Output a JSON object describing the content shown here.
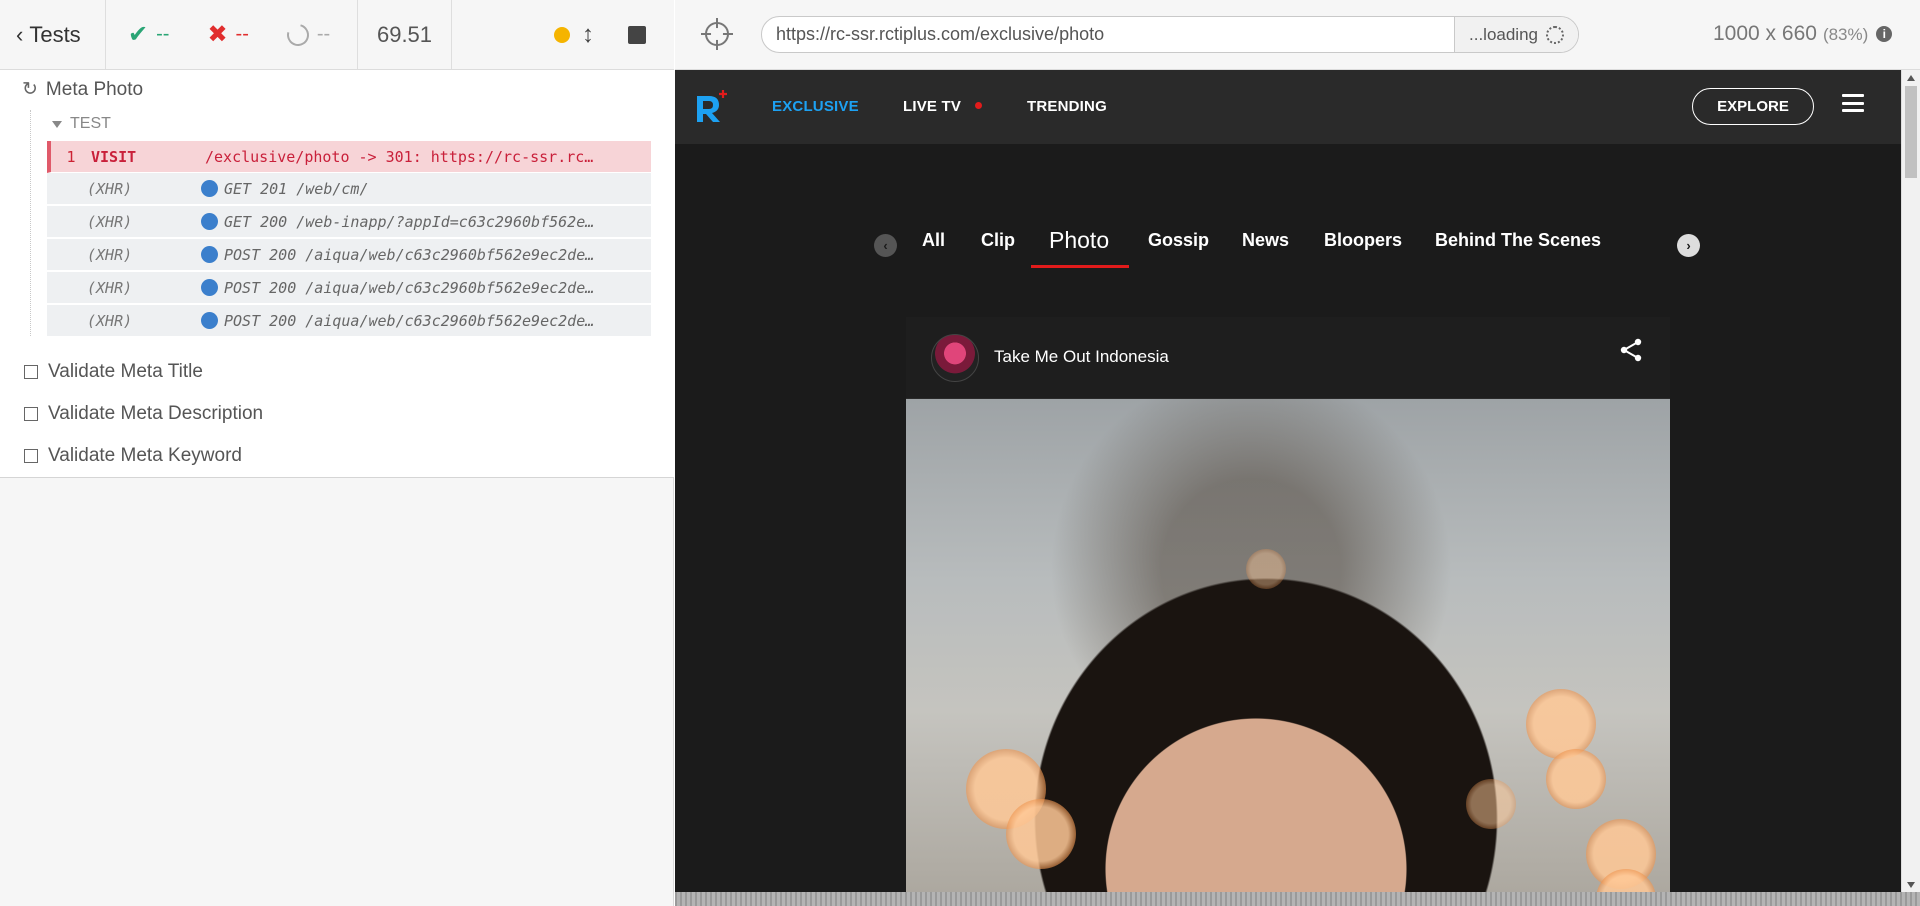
{
  "reporter": {
    "header": {
      "tests_label": "Tests",
      "passed": "--",
      "failed": "--",
      "pending": "--",
      "duration": "69.51"
    },
    "suite": {
      "title": "Meta Photo",
      "test_label": "TEST",
      "commands": [
        {
          "num": "1",
          "name": "VISIT",
          "message": "/exclusive/photo -> 301: https://rc-ssr.rc…",
          "type": "visit"
        },
        {
          "num": "",
          "name": "(XHR)",
          "message": "GET 201 /web/cm/",
          "type": "xhr"
        },
        {
          "num": "",
          "name": "(XHR)",
          "message": "GET 200 /web-inapp/?appId=c63c2960bf562e…",
          "type": "xhr"
        },
        {
          "num": "",
          "name": "(XHR)",
          "message": "POST 200 /aiqua/web/c63c2960bf562e9ec2de…",
          "type": "xhr"
        },
        {
          "num": "",
          "name": "(XHR)",
          "message": "POST 200 /aiqua/web/c63c2960bf562e9ec2de…",
          "type": "xhr"
        },
        {
          "num": "",
          "name": "(XHR)",
          "message": "POST 200 /aiqua/web/c63c2960bf562e9ec2de…",
          "type": "xhr"
        }
      ],
      "pending_tests": [
        "Validate Meta Title",
        "Validate Meta Description",
        "Validate Meta Keyword"
      ]
    }
  },
  "aut": {
    "url": "https://rc-ssr.rctiplus.com/exclusive/photo",
    "status": "...loading",
    "viewport": "1000 x 660",
    "scale": "(83%)",
    "site": {
      "nav": [
        "EXCLUSIVE",
        "LIVE TV",
        "TRENDING"
      ],
      "explore": "EXPLORE",
      "categories": [
        "All",
        "Clip",
        "Photo",
        "Gossip",
        "News",
        "Bloopers",
        "Behind The Scenes"
      ],
      "active_category": "Photo",
      "post": {
        "channel": "Take Me Out Indonesia"
      },
      "colors": {
        "accent": "#1da1f2",
        "live": "#e21b1b",
        "background": "#1b1b1b"
      }
    }
  }
}
